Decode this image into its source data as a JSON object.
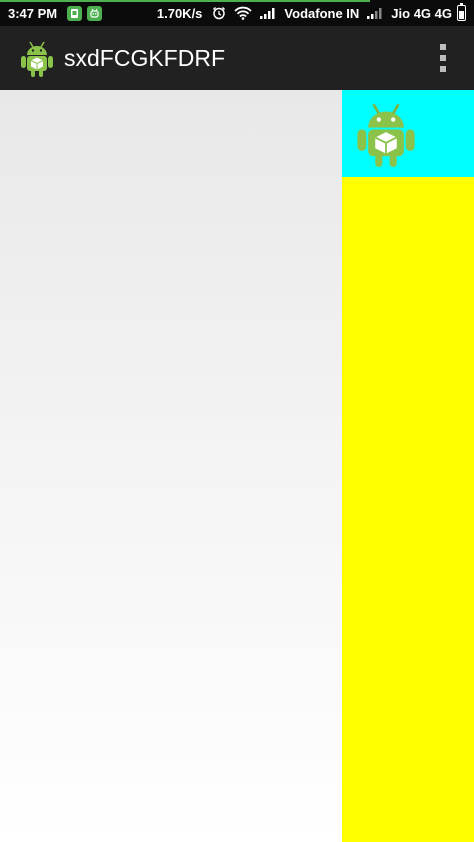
{
  "status_bar": {
    "time": "3:47 PM",
    "speed": "1.70K/s",
    "carrier1": "Vodafone IN",
    "carrier2": "Jio 4G 4G",
    "progress": 0.78,
    "battery_level": 0.7,
    "icons": [
      "sim-app-icon",
      "android-app-icon",
      "alarm-icon",
      "wifi-icon",
      "signal-icon",
      "signal-icon",
      "battery-icon"
    ]
  },
  "action_bar": {
    "title": "sxdFCGKFDRF",
    "logo_icon": "android-icon",
    "menu_icon": "overflow-menu-icon"
  },
  "side_panel": {
    "header_color": "#00ffff",
    "body_color": "#ffff00",
    "icon": "android-icon"
  },
  "colors": {
    "status_bar": "#0b0b0b",
    "action_bar": "#212121",
    "android_green": "#8bc34a"
  }
}
